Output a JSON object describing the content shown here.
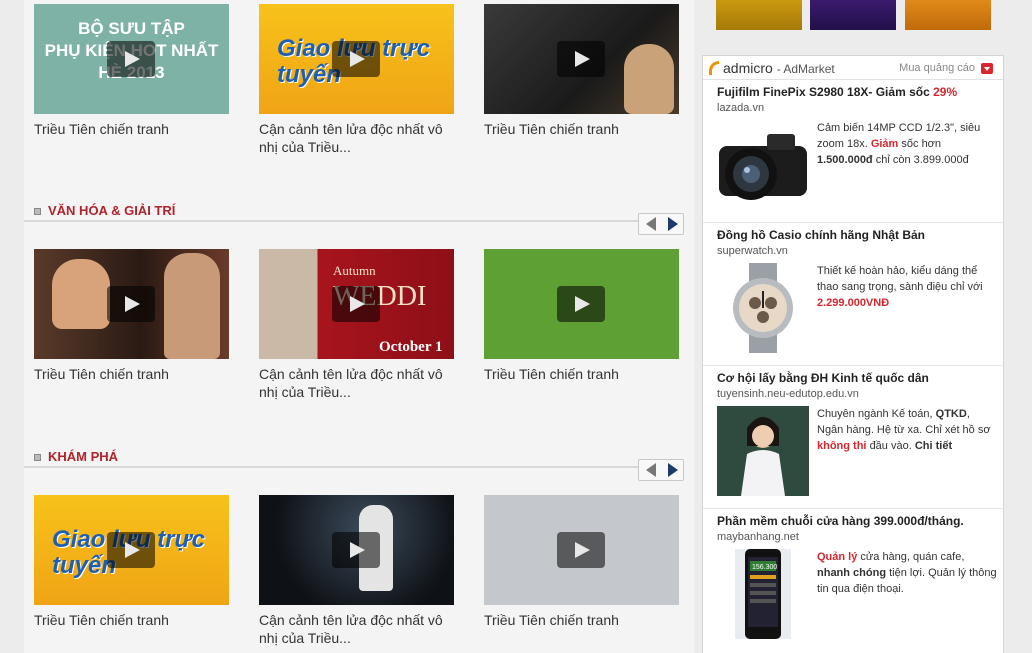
{
  "sections": [
    {
      "title": "VĂN HÓA & GIẢI TRÍ"
    },
    {
      "title": "KHÁM PHÁ"
    }
  ],
  "videos_top": [
    {
      "title": "Triều Tiên chiến tranh",
      "thumb_text": "BỘ SƯU TẬP\nPHỤ KIỆN HOT NHẤT\nHÈ 2013"
    },
    {
      "title": "Cận cảnh tên lửa độc nhất vô nhị của Triều...",
      "thumb_text": "Giao lưu trực tuyến"
    },
    {
      "title": "Triều Tiên chiến tranh"
    }
  ],
  "videos_mid": [
    {
      "title": "Triều Tiên chiến tranh"
    },
    {
      "title": "Cận cảnh tên lửa độc nhất vô nhị của Triều...",
      "thumb_text_1": "Autumn",
      "thumb_text_2": "WEDDI",
      "thumb_text_3": "October 1"
    },
    {
      "title": "Triều Tiên chiến tranh"
    }
  ],
  "videos_bottom": [
    {
      "title": "Triều Tiên chiến tranh",
      "thumb_text": "Giao lưu trực tuyến"
    },
    {
      "title": "Cận cảnh tên lửa độc nhất vô nhị của Triều..."
    },
    {
      "title": "Triều Tiên chiến tranh"
    }
  ],
  "ad": {
    "brand": "admicro",
    "market": "- AdMarket",
    "buy_label": "Mua quảng cáo",
    "items": [
      {
        "title": "Fujifilm FinePix S2980 18X- Giảm sốc",
        "title_hl": "29%",
        "domain": "lazada.vn",
        "desc_1": "Cảm biến 14MP CCD 1/2.3\", siêu zoom 18x.",
        "desc_red": "Giảm",
        "desc_2": "sốc hơn",
        "desc_price": "1.500.000đ",
        "desc_3": "chỉ còn 3.899.000đ"
      },
      {
        "title": "Đồng hồ Casio chính hãng Nhật Bản",
        "domain": "superwatch.vn",
        "desc_1": "Thiết kế hoàn hảo, kiểu dáng thể thao sang trọng, sành điệu chỉ với",
        "desc_price": "2.299.000VNĐ"
      },
      {
        "title": "Cơ hội lấy bằng ĐH Kinh tế quốc dân",
        "domain": "tuyensinh.neu-edutop.edu.vn",
        "desc_1": "Chuyên ngành Kế toán,",
        "desc_b1": "QTKD",
        "desc_2": ", Ngân hàng. Hệ từ xa. Chỉ xét hồ sơ",
        "desc_red": "không thi",
        "desc_3": "đầu vào.",
        "desc_b2": "Chi tiết"
      },
      {
        "title": "Phần mềm chuỗi cửa hàng 399.000đ/tháng.",
        "domain": "maybanhang.net",
        "desc_red": "Quản lý",
        "desc_1": "cửa hàng, quán cafe,",
        "desc_b1": "nhanh chóng",
        "desc_2": "tiện lợi. Quản lý thông tin qua điện thoại.",
        "phone_text": "156.300"
      }
    ]
  },
  "colors": {
    "section_title": "#b0232a",
    "accent_red": "#d8262e",
    "admicro_orange": "#f39200"
  }
}
